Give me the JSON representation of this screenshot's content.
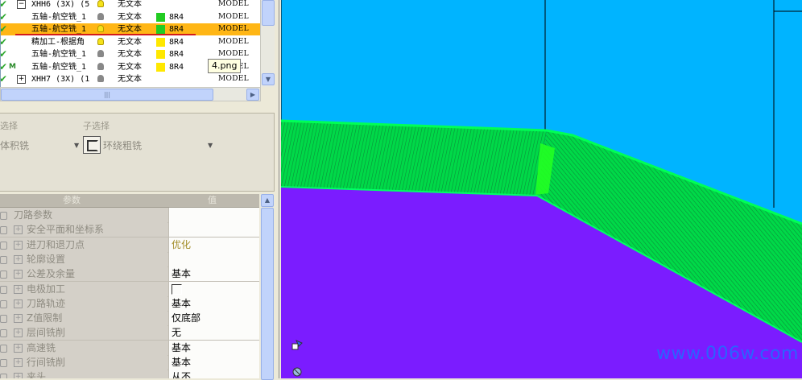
{
  "tree": {
    "rows": [
      {
        "name": "XHH6 (3X) (5",
        "text": "无文本",
        "tool": "",
        "model": "MODEL",
        "swatch": "",
        "expander": "−",
        "bulb": "on",
        "selected": false
      },
      {
        "name": "五轴-航空铣_1",
        "text": "无文本",
        "tool": "8R4",
        "model": "MODEL",
        "swatch": "#22CC22",
        "expander": "",
        "bulb": "off",
        "selected": false
      },
      {
        "name": "五轴-航空铣_1",
        "text": "无文本",
        "tool": "8R4",
        "model": "MODEL",
        "swatch": "#22CC22",
        "expander": "",
        "bulb": "on",
        "selected": true
      },
      {
        "name": "精加工-根据角",
        "text": "无文本",
        "tool": "8R4",
        "model": "MODEL",
        "swatch": "#FFE800",
        "expander": "",
        "bulb": "on",
        "selected": false
      },
      {
        "name": "五轴-航空铣_1",
        "text": "无文本",
        "tool": "8R4",
        "model": "MODEL",
        "swatch": "#FFE800",
        "expander": "",
        "bulb": "off",
        "selected": false
      },
      {
        "name": "五轴-航空铣_1",
        "text": "无文本",
        "tool": "8R4",
        "model": "MODEL",
        "swatch": "#FFE800",
        "expander": "",
        "bulb": "off",
        "selected": false
      },
      {
        "name": "XHH7 (3X) (1",
        "text": "无文本",
        "tool": "",
        "model": "MODEL",
        "swatch": "",
        "expander": "+",
        "bulb": "off",
        "selected": false
      }
    ],
    "m_marker": "M",
    "tooltip": "4.png",
    "scroll_grip": "|||"
  },
  "strategy": {
    "main_label": "选择",
    "main_value": "体积铣",
    "sub_label": "子选择",
    "sub_value": "环绕粗铣"
  },
  "params": {
    "header_name": "参数",
    "header_value": "值",
    "rows": [
      {
        "name": "刀路参数",
        "value": "",
        "top": true
      },
      {
        "name": "安全平面和坐标系",
        "value": ""
      },
      {
        "name": "进刀和退刀点",
        "value": "优化",
        "gold": true
      },
      {
        "name": "轮廓设置",
        "value": ""
      },
      {
        "name": "公差及余量",
        "value": "基本"
      },
      {
        "name": "电极加工",
        "value": "",
        "checkbox": true
      },
      {
        "name": "刀路轨迹",
        "value": "基本"
      },
      {
        "name": "Z值限制",
        "value": "仅底部"
      },
      {
        "name": "层间铣削",
        "value": "无"
      },
      {
        "name": "高速铣",
        "value": "基本"
      },
      {
        "name": "行间铣削",
        "value": "基本"
      },
      {
        "name": "夹头",
        "value": "从不"
      }
    ]
  },
  "viewport": {
    "watermark": "www.006w.com",
    "colors": {
      "background": "#00B4FF",
      "floor": "#7B1CFF",
      "toolpath": "#00D948"
    }
  }
}
